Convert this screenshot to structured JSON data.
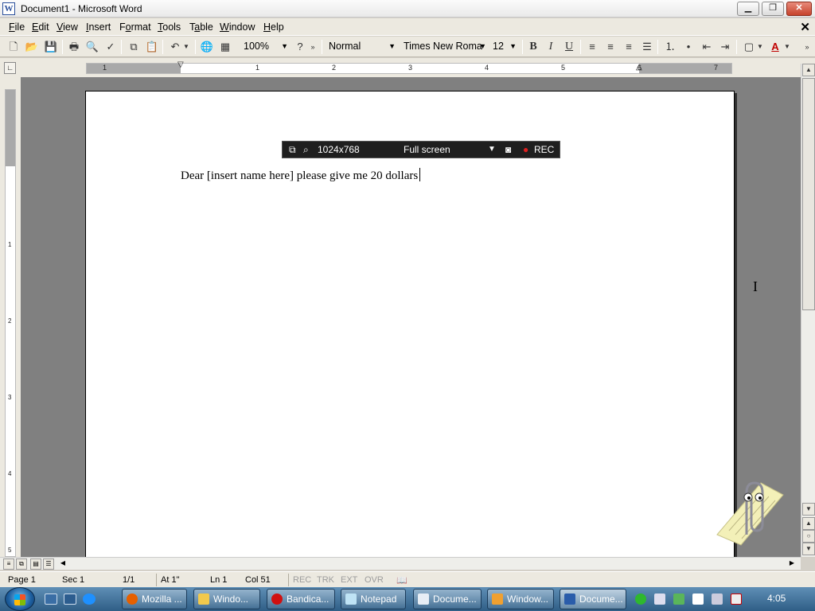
{
  "window": {
    "title": "Document1 - Microsoft Word",
    "minimize_icon": "minimize-icon",
    "restore_icon": "restore-icon",
    "close_icon": "close-icon"
  },
  "menu": [
    {
      "label": "File",
      "key": "F",
      "rest": "ile"
    },
    {
      "label": "Edit",
      "key": "E",
      "rest": "dit"
    },
    {
      "label": "View",
      "key": "V",
      "rest": "iew"
    },
    {
      "label": "Insert",
      "key": "I",
      "rest": "nsert"
    },
    {
      "label": "Format",
      "key": "o",
      "pre": "F",
      "rest": "rmat"
    },
    {
      "label": "Tools",
      "key": "T",
      "rest": "ools"
    },
    {
      "label": "Table",
      "key": "a",
      "pre": "T",
      "rest": "ble"
    },
    {
      "label": "Window",
      "key": "W",
      "rest": "indow"
    },
    {
      "label": "Help",
      "key": "H",
      "rest": "elp"
    }
  ],
  "toolbar": {
    "zoom": "100%",
    "style": "Normal",
    "font": "Times New Roma",
    "font_size": "12",
    "bold": "B",
    "italic": "I",
    "underline": "U",
    "font_color_glyph": "A"
  },
  "ruler": {
    "h_numbers": [
      "1",
      "1",
      "2",
      "3",
      "4",
      "5",
      "6",
      "7"
    ],
    "v_numbers": [
      "1",
      "2",
      "3",
      "4",
      "5"
    ]
  },
  "document": {
    "text": "Dear [insert name here] please give me 20 dollars"
  },
  "recorder": {
    "resolution": "1024x768",
    "mode": "Full screen",
    "rec_label": "REC"
  },
  "status": {
    "page": "Page  1",
    "sec": "Sec  1",
    "pages": "1/1",
    "at": "At  1\"",
    "ln": "Ln  1",
    "col": "Col  51",
    "rec": "REC",
    "trk": "TRK",
    "ext": "EXT",
    "ovr": "OVR"
  },
  "taskbar": {
    "tasks": [
      "Mozilla ...",
      "Windo...",
      "Bandica...",
      "Notepad",
      "Docume...",
      "Window...",
      "Docume..."
    ],
    "clock": "4:05"
  }
}
